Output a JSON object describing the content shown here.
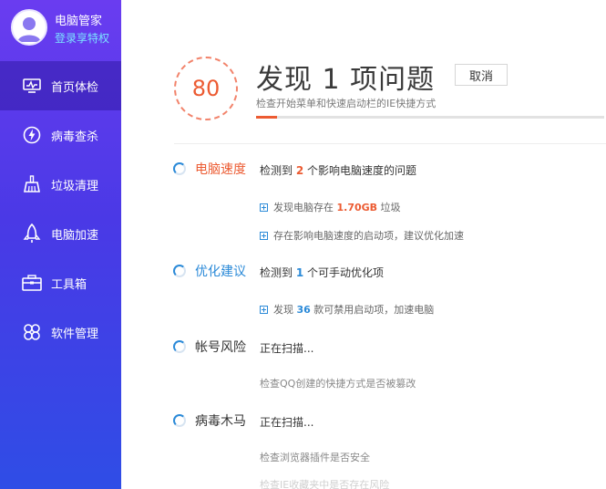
{
  "profile": {
    "name": "电脑管家",
    "login_label": "登录享特权"
  },
  "nav": {
    "items": [
      {
        "label": "首页体检",
        "icon": "monitor-icon",
        "active": true
      },
      {
        "label": "病毒查杀",
        "icon": "lightning-icon",
        "active": false
      },
      {
        "label": "垃圾清理",
        "icon": "broom-icon",
        "active": false
      },
      {
        "label": "电脑加速",
        "icon": "rocket-icon",
        "active": false
      },
      {
        "label": "工具箱",
        "icon": "toolbox-icon",
        "active": false
      },
      {
        "label": "软件管理",
        "icon": "apps-icon",
        "active": false
      }
    ]
  },
  "scan": {
    "score": "80",
    "headline": "发现 1 项问题",
    "cancel_label": "取消",
    "status": "检查开始菜单和快速启动栏的IE快捷方式",
    "progress": 0.06
  },
  "sections": {
    "speed": {
      "title": "电脑速度",
      "summary_pre": "检测到 ",
      "summary_count": "2",
      "summary_post": " 个影响电脑速度的问题",
      "detail1_pre": "发现电脑存在 ",
      "detail1_value": "1.70GB",
      "detail1_post": " 垃圾",
      "detail2": "存在影响电脑速度的启动项，建议优化加速"
    },
    "optimize": {
      "title": "优化建议",
      "summary_pre": "检测到 ",
      "summary_count": "1",
      "summary_post": " 个可手动优化项",
      "detail1_pre": "发现 ",
      "detail1_value": "36",
      "detail1_post": " 款可禁用启动项，加速电脑"
    },
    "account": {
      "title": "帐号风险",
      "status": "正在扫描...",
      "detail": "检查QQ创建的快捷方式是否被篡改"
    },
    "virus": {
      "title": "病毒木马",
      "status": "正在扫描...",
      "detail1": "检查浏览器插件是否安全",
      "detail2": "检查IE收藏夹中是否存在风险"
    }
  },
  "colors": {
    "accent_orange": "#ec5b32",
    "accent_blue": "#2b8ad8",
    "sidebar_top": "#6a3cf0",
    "sidebar_bottom": "#2f4de6"
  }
}
